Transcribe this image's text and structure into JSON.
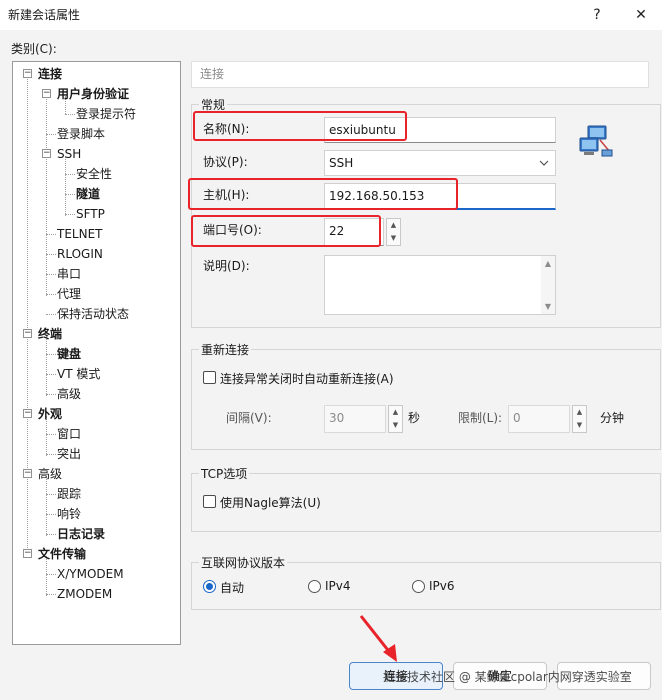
{
  "window": {
    "title": "新建会话属性",
    "help": "?",
    "close": "✕"
  },
  "category_label": "类别(C):",
  "tree": [
    {
      "label": "连接",
      "bold": true,
      "expander": "−"
    },
    {
      "label": "用户身份验证",
      "bold": true,
      "expander": "−"
    },
    {
      "label": "登录提示符",
      "bold": false
    },
    {
      "label": "登录脚本",
      "bold": false
    },
    {
      "label": "SSH",
      "bold": false,
      "expander": "−"
    },
    {
      "label": "安全性",
      "bold": false
    },
    {
      "label": "隧道",
      "bold": true
    },
    {
      "label": "SFTP",
      "bold": false
    },
    {
      "label": "TELNET",
      "bold": false
    },
    {
      "label": "RLOGIN",
      "bold": false
    },
    {
      "label": "串口",
      "bold": false
    },
    {
      "label": "代理",
      "bold": false
    },
    {
      "label": "保持活动状态",
      "bold": false
    },
    {
      "label": "终端",
      "bold": true,
      "expander": "−"
    },
    {
      "label": "键盘",
      "bold": true
    },
    {
      "label": "VT 模式",
      "bold": false
    },
    {
      "label": "高级",
      "bold": false
    },
    {
      "label": "外观",
      "bold": true,
      "expander": "−"
    },
    {
      "label": "窗口",
      "bold": false
    },
    {
      "label": "突出",
      "bold": false
    },
    {
      "label": "高级",
      "bold": false,
      "expander": "−"
    },
    {
      "label": "跟踪",
      "bold": false
    },
    {
      "label": "响铃",
      "bold": false
    },
    {
      "label": "日志记录",
      "bold": true
    },
    {
      "label": "文件传输",
      "bold": true,
      "expander": "−"
    },
    {
      "label": "X/YMODEM",
      "bold": false
    },
    {
      "label": "ZMODEM",
      "bold": false
    }
  ],
  "breadcrumb": "连接",
  "general": {
    "title": "常规",
    "name_label": "名称(N):",
    "name_value": "esxiubuntu",
    "protocol_label": "协议(P):",
    "protocol_value": "SSH",
    "host_label": "主机(H):",
    "host_value": "192.168.50.153",
    "port_label": "端口号(O):",
    "port_value": "22",
    "desc_label": "说明(D):",
    "desc_value": ""
  },
  "reconnect": {
    "title": "重新连接",
    "checkbox_label": "连接异常关闭时自动重新连接(A)",
    "interval_label": "间隔(V):",
    "interval_value": "30",
    "interval_unit": "秒",
    "limit_label": "限制(L):",
    "limit_value": "0",
    "limit_unit": "分钟"
  },
  "tcp": {
    "title": "TCP选项",
    "nagle_label": "使用Nagle算法(U)"
  },
  "ip_version": {
    "title": "互联网协议版本",
    "options": [
      "自动",
      "IPv4",
      "IPv6"
    ],
    "selected": "自动"
  },
  "buttons": {
    "connect": "连接",
    "ok": "确定"
  },
  "watermark": "掘金技术社区 @ 某鲸鱼cpolar内网穿透实验室",
  "colors": {
    "highlight": "#e8232a",
    "accent": "#1a66c9"
  },
  "icons": {
    "session": "network-computers-icon",
    "arrow": "red-arrow-annotation"
  }
}
